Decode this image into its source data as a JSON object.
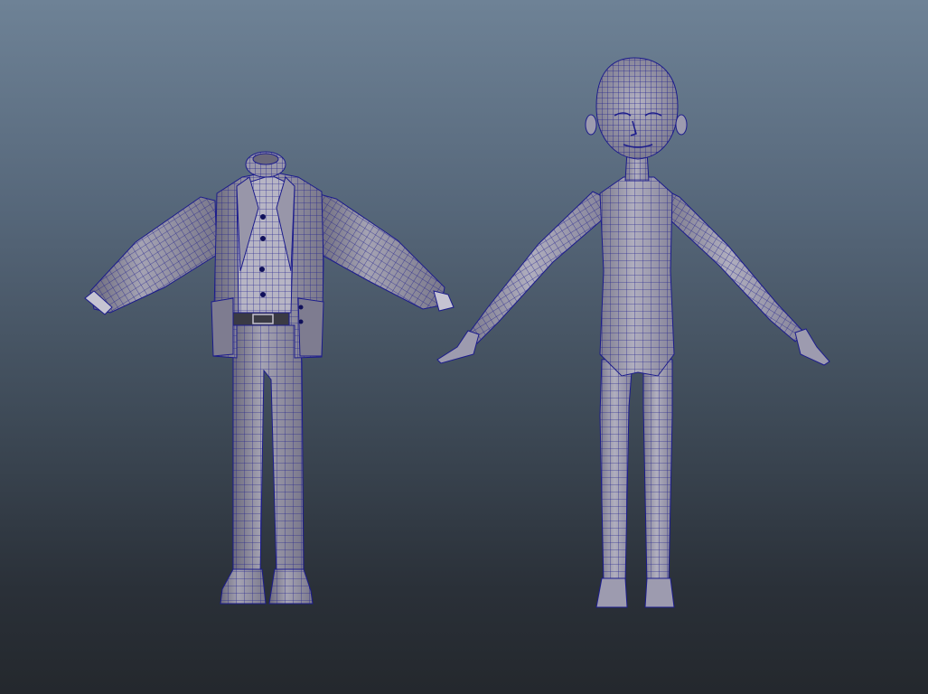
{
  "viewport": {
    "background_top": "#6e8296",
    "background_bottom": "#24282d",
    "shading_mode": "wireframe-on-shaded"
  },
  "colors": {
    "wire": "#1c1c8c",
    "shade_light": "#a5a3b3",
    "shade_mid": "#8f8da0",
    "shade_dark": "#6c6a7c",
    "belt": "#3a3a44",
    "buttons": "#10105a"
  },
  "models": [
    {
      "name": "clothing-outfit-model",
      "icon": "jacket-shirt-pants-shoes"
    },
    {
      "name": "character-body-model",
      "icon": "base-body-t-pose"
    }
  ]
}
